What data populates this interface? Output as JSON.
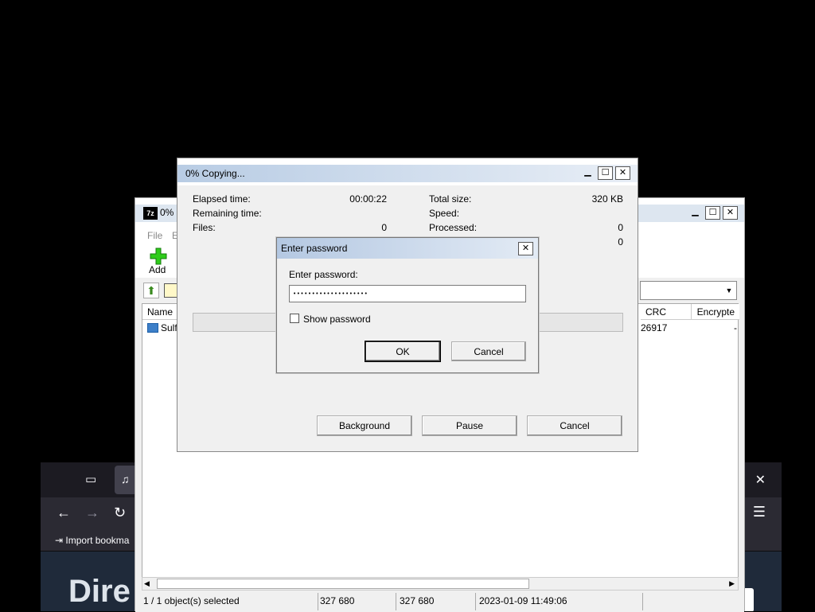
{
  "browser": {
    "bookmark_import": "Import bookma",
    "hero_text": "Dire"
  },
  "archive_window": {
    "title": "0% (",
    "icon_text": "7z",
    "menu": [
      "File",
      "E"
    ],
    "toolbar": {
      "add_label": "Add"
    },
    "columns": {
      "name": "Name",
      "crc": "CRC",
      "encrypted": "Encrypte"
    },
    "rows": [
      {
        "name": "Sulf",
        "crc": "26917",
        "encrypted": "-"
      }
    ],
    "status": {
      "selection": "1 / 1 object(s) selected",
      "size": "327 680",
      "packed": "327 680",
      "modified": "2023-01-09 11:49:06"
    }
  },
  "copy_dialog": {
    "title": "0% Copying...",
    "elapsed_label": "Elapsed time:",
    "elapsed_value": "00:00:22",
    "remaining_label": "Remaining time:",
    "files_label": "Files:",
    "files_value": "0",
    "total_size_label": "Total size:",
    "total_size_value": "320 KB",
    "speed_label": "Speed:",
    "processed_label": "Processed:",
    "processed_value": "0",
    "extra_value": "0",
    "progress": 0,
    "buttons": {
      "background": "Background",
      "pause": "Pause",
      "cancel": "Cancel"
    }
  },
  "password_dialog": {
    "title": "Enter password",
    "prompt": "Enter password:",
    "password_masked": "••••••••••••••••••••",
    "show_password_label": "Show password",
    "show_password_checked": false,
    "ok_label": "OK",
    "cancel_label": "Cancel"
  }
}
